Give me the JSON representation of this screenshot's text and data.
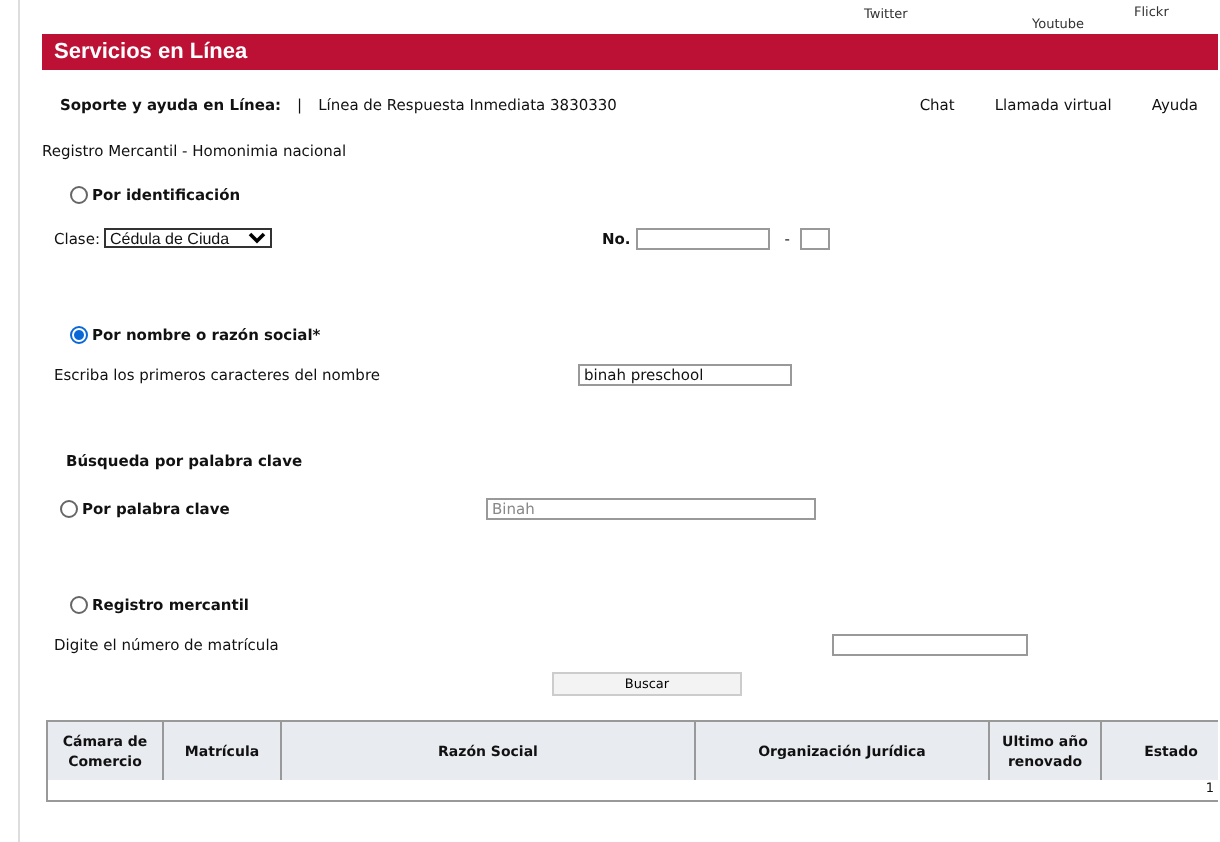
{
  "social_links": [
    "Twitter",
    "Youtube",
    "Flickr"
  ],
  "header": {
    "title": "Servicios en Línea"
  },
  "support_bar": {
    "label": "Soporte y ayuda en Línea:",
    "separator": "|",
    "phone": "Línea de Respuesta Inmediata 3830330",
    "links": [
      "Chat",
      "Llamada virtual",
      "Ayuda"
    ]
  },
  "breadcrumb": "Registro Mercantil - Homonimia nacional",
  "search_options": [
    {
      "kind": "identification",
      "label": "Por identificación",
      "selected": false,
      "clase_label": "Clase:",
      "clase_value": "Cédula de Ciuda",
      "number_label": "No.",
      "separator": "-"
    },
    {
      "kind": "name",
      "label": "Por nombre o razón social*",
      "selected": true,
      "field_label": "Escriba los primeros caracteres del nombre",
      "value": "binah preschool"
    },
    {
      "kind": "keyword",
      "heading": "Búsqueda por palabra clave",
      "label": "Por palabra clave",
      "selected": false,
      "placeholder": "Binah"
    },
    {
      "kind": "registry",
      "label": "Registro mercantil",
      "selected": false,
      "field_label": "Digite el número de matrícula"
    }
  ],
  "search_button": "Buscar",
  "results_table": {
    "columns": [
      "Cámara de Comercio",
      "Matrícula",
      "Razón Social",
      "Organización Jurídica",
      "Ultimo año renovado",
      "Estado"
    ],
    "pager": "1"
  }
}
